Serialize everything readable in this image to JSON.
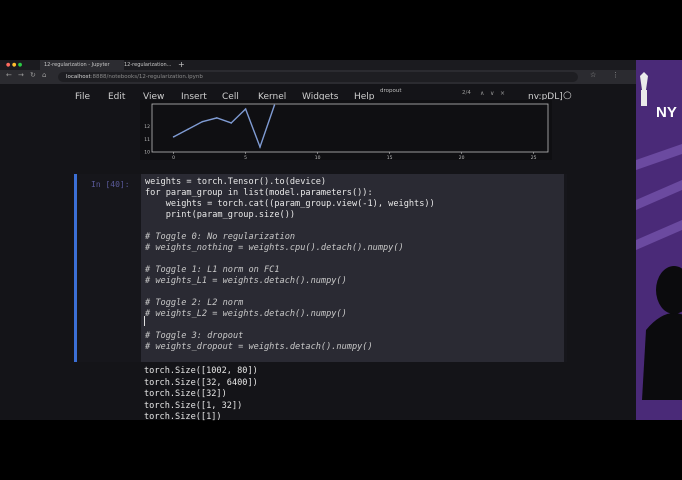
{
  "browser": {
    "tabs": [
      {
        "label": "12-regularization - Jupyter Notebook",
        "active": true
      },
      {
        "label": "12-regularization...",
        "active": false
      }
    ],
    "new_tab": "+",
    "url_host": "localhost",
    "url_path": ":8888/notebooks/12-regularization.ipynb"
  },
  "jupyter": {
    "menu": [
      "File",
      "Edit",
      "View",
      "Insert",
      "Cell",
      "Kernel",
      "Widgets",
      "Help"
    ],
    "toolbar_hint": "dropout",
    "toolbar_counter": "2/4",
    "kernel_name": "nv:pDL]"
  },
  "chart_data": {
    "type": "line",
    "x": [
      0,
      1,
      2,
      3,
      4,
      5,
      6,
      7
    ],
    "y": [
      11.2,
      11.8,
      12.4,
      12.7,
      12.3,
      13.4,
      10.4,
      13.7
    ],
    "xlim": [
      -1.5,
      26
    ],
    "ylim": [
      10,
      13.8
    ],
    "xticks": [
      "0",
      "5",
      "10",
      "15",
      "20",
      "25"
    ],
    "yticks": [
      "12",
      "11",
      "10"
    ],
    "series_color": "#7f9bd3"
  },
  "cell": {
    "prompt": "In [40]:",
    "lines": [
      {
        "t": "weights = torch.Tensor().to(device)",
        "c": false
      },
      {
        "t": "for param_group in list(model.parameters()):",
        "c": false
      },
      {
        "t": "    weights = torch.cat((param_group.view(-1), weights))",
        "c": false
      },
      {
        "t": "    print(param_group.size())",
        "c": false
      },
      {
        "t": "",
        "c": false
      },
      {
        "t": "# Toggle 0: No regularization",
        "c": true
      },
      {
        "t": "# weights_nothing = weights.cpu().detach().numpy()",
        "c": true
      },
      {
        "t": "",
        "c": false
      },
      {
        "t": "# Toggle 1: L1 norm on FC1",
        "c": true
      },
      {
        "t": "# weights_L1 = weights.detach().numpy()",
        "c": true
      },
      {
        "t": "",
        "c": false
      },
      {
        "t": "# Toggle 2: L2 norm",
        "c": true
      },
      {
        "t": "# weights_L2 = weights.detach().numpy()",
        "c": true
      },
      {
        "t": "",
        "c": false
      },
      {
        "t": "# Toggle 3: dropout",
        "c": true
      },
      {
        "t": "# weights_dropout = weights.detach().numpy()",
        "c": true
      }
    ]
  },
  "output": [
    "torch.Size([1002, 80])",
    "torch.Size([32, 6400])",
    "torch.Size([32])",
    "torch.Size([1, 32])",
    "torch.Size([1])"
  ],
  "side_panel": {
    "logo_text": "NY",
    "background": "#4a2a78"
  }
}
